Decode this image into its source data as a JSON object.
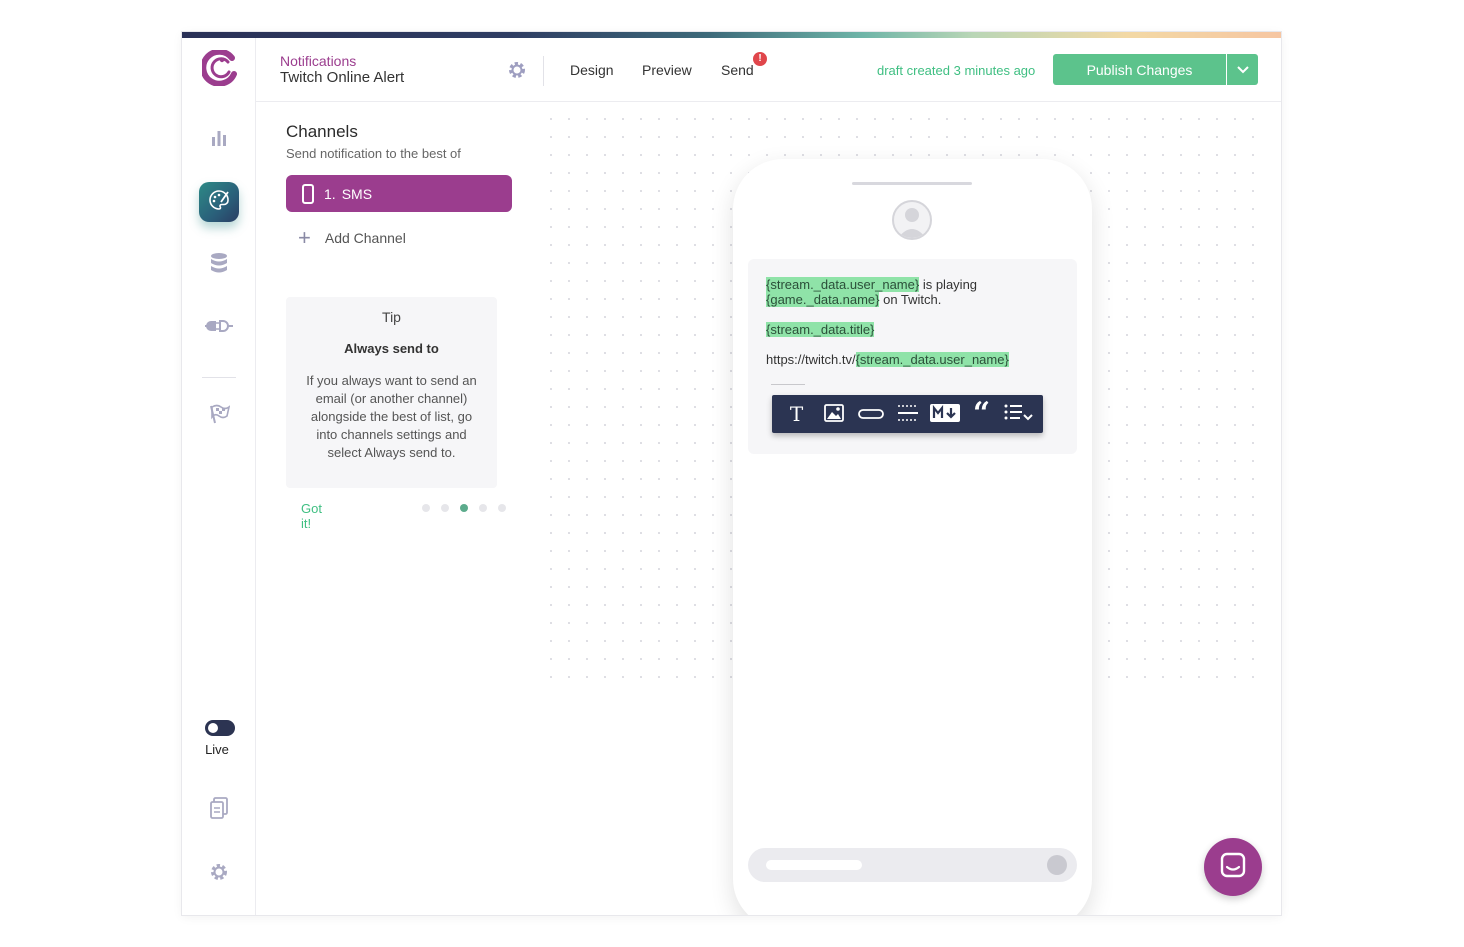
{
  "colors": {
    "brand_purple": "#9b3d8e",
    "accent_green": "#5cc38c",
    "nav_dark": "#2c3452",
    "variable_highlight": "#8fe3a8",
    "alert_red": "#e0464b"
  },
  "sidebar": {
    "items": [
      {
        "name": "analytics",
        "icon": "bar-chart-icon"
      },
      {
        "name": "designer",
        "icon": "palette-icon",
        "active": true
      },
      {
        "name": "data",
        "icon": "database-icon"
      },
      {
        "name": "integrations",
        "icon": "plug-icon"
      },
      {
        "name": "brands",
        "icon": "flag-icon"
      }
    ],
    "live_label": "Live",
    "bottom_icons": [
      "documents-icon",
      "gear-icon"
    ]
  },
  "header": {
    "section": "Notifications",
    "title": "Twitch Online Alert",
    "tabs": [
      "Design",
      "Preview",
      "Send"
    ],
    "send_alert": "!",
    "draft_status": "draft created 3 minutes ago",
    "publish_label": "Publish Changes"
  },
  "channels": {
    "title": "Channels",
    "subtitle": "Send notification to the best of",
    "items": [
      {
        "index": "1.",
        "label": "SMS",
        "icon": "phone-icon"
      }
    ],
    "add_label": "Add Channel"
  },
  "tip": {
    "heading": "Tip",
    "subheading": "Always send to",
    "body": "If you always want to send an email (or another channel) alongside the best of list, go into channels settings and select Always send to.",
    "action": "Got it!",
    "pages": 5,
    "current_page": 3
  },
  "message": {
    "var_user": "{stream._data.user_name}",
    "text_playing": " is playing",
    "var_game": "{game._data.name}",
    "text_on_twitch": " on Twitch.",
    "var_title": "{stream._data.title}",
    "url_prefix": "https://twitch.tv/",
    "var_user_url": "{stream._data.user_name}"
  },
  "toolbar": {
    "buttons": [
      "text-icon",
      "image-icon",
      "action-button-icon",
      "divider-icon",
      "markdown-icon",
      "quote-icon",
      "list-icon"
    ]
  }
}
